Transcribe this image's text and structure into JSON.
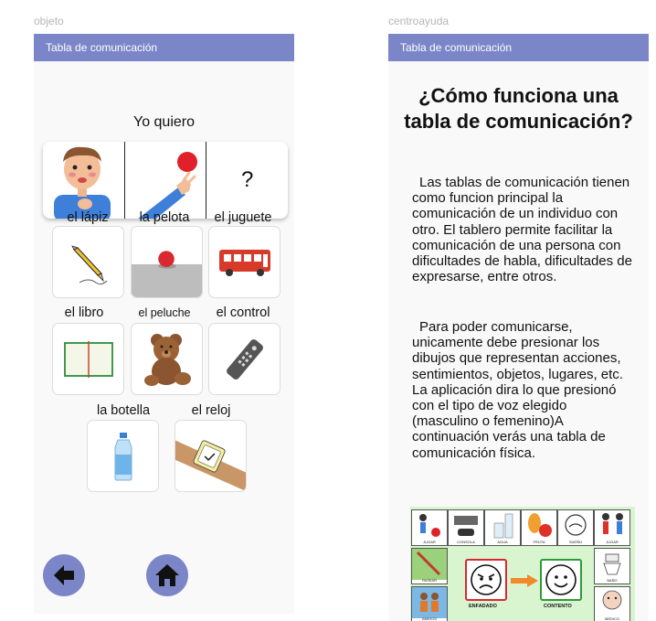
{
  "left_frame": {
    "label": "objeto",
    "appbar_title": "Tabla de comunicación",
    "phrase": "Yo quiero",
    "strip": {
      "placeholder": "?"
    },
    "items": [
      {
        "label": "el lápiz",
        "icon": "pencil-icon"
      },
      {
        "label": "la pelota",
        "icon": "ball-icon"
      },
      {
        "label": "el juguete",
        "icon": "toy-bus-icon"
      },
      {
        "label": "el libro",
        "icon": "book-icon"
      },
      {
        "label": "el peluche",
        "icon": "teddy-bear-icon"
      },
      {
        "label": "el control",
        "icon": "remote-control-icon"
      },
      {
        "label": "la botella",
        "icon": "bottle-icon"
      },
      {
        "label": "el reloj",
        "icon": "watch-icon"
      }
    ],
    "nav": {
      "back": "arrow-left-icon",
      "home": "home-icon"
    },
    "accent": "#7b86c8"
  },
  "right_frame": {
    "label": "centroayuda",
    "appbar_title": "Tabla de comunicación",
    "title": "¿Cómo funciona una tabla de comunicación?",
    "paragraph1": "Las tablas de comunicación tienen como funcion principal la comunicación de un individuo con otro. El tablero permite facilitar la comunicación de una persona con dificultades de habla, dificultades de expresarse, entre otros.",
    "paragraph2": "Para poder comunicarse, unicamente debe presionar los dibujos que representan acciones, sentimientos, objetos, lugares, etc. La aplicación dira lo que presionó con el tipo de voz elegido (masculino o femenino)A continuación verás una tabla de comunicación física.",
    "board": {
      "captions_top": [
        "JUGAR",
        "CONSOLA",
        "AGUA",
        "FRUTA",
        "SUEÑO",
        "JUGAR"
      ],
      "captions_side_left": [
        "PASEAR",
        "AMIGOS"
      ],
      "captions_side_right": [
        "BAÑO",
        "MÉDICO"
      ],
      "face_left": "ENFADADO",
      "face_right": "CONTENTO"
    }
  }
}
